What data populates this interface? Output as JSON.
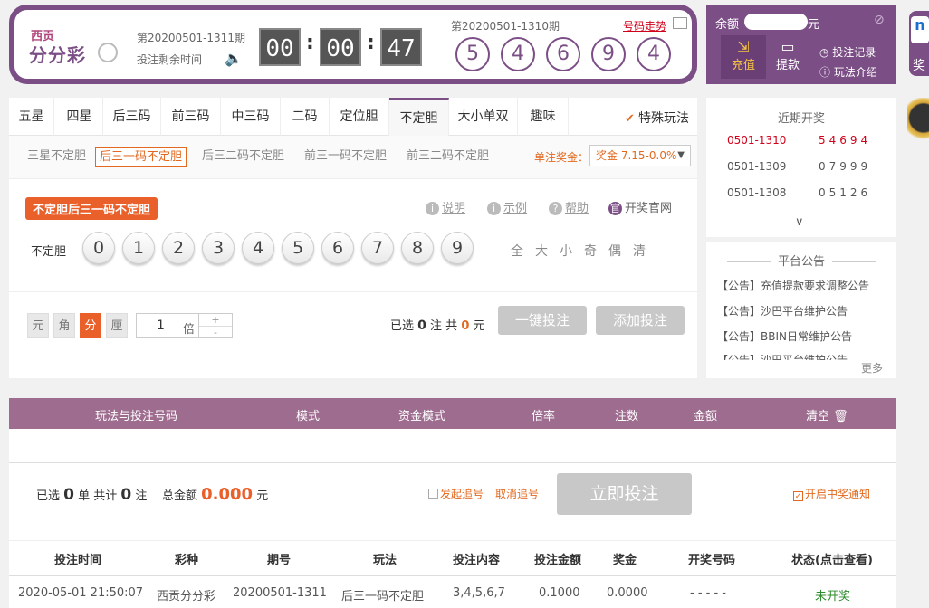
{
  "header": {
    "logo_small": "西贡",
    "logo_big": "分分彩",
    "period": "第20200501-1311期",
    "remain_label": "投注剩余时间",
    "timer": [
      "00",
      "00",
      "47"
    ],
    "prev_period": "第20200501-1310期",
    "trend_link": "号码走势",
    "prev_balls": [
      "5",
      "4",
      "6",
      "9",
      "4"
    ]
  },
  "account": {
    "balance_label": "余额",
    "balance_unit": "元",
    "recharge": "充值",
    "withdraw": "提款",
    "bet_records": "投注记录",
    "rules": "玩法介绍"
  },
  "side_strip": {
    "logo": "n",
    "label": "奖"
  },
  "tabs": [
    "五星",
    "四星",
    "后三码",
    "前三码",
    "中三码",
    "二码",
    "定位胆",
    "不定胆",
    "大小单双",
    "趣味"
  ],
  "special": "特殊玩法",
  "subtabs": [
    "三星不定胆",
    "后三一码不定胆",
    "后三二码不定胆",
    "前三一码不定胆",
    "前三二码不定胆"
  ],
  "prize": {
    "label": "单注奖金：",
    "value": "奖金 7.15-0.0%"
  },
  "badge": "不定胆后三一码不定胆",
  "helps": [
    "说明",
    "示例",
    "帮助"
  ],
  "official": "开奖官网",
  "row_label": "不定胆",
  "numbers": [
    "0",
    "1",
    "2",
    "3",
    "4",
    "5",
    "6",
    "7",
    "8",
    "9"
  ],
  "quick": [
    "全",
    "大",
    "小",
    "奇",
    "偶",
    "清"
  ],
  "units": [
    "元",
    "角",
    "分",
    "厘"
  ],
  "multiplier": {
    "value": "1",
    "unit": "倍"
  },
  "selection": {
    "prefix": "已选",
    "count": "0",
    "mid": "注 共",
    "amount": "0",
    "suffix": "元"
  },
  "one_key_bet": "一键投注",
  "add_bet": "添加投注",
  "recent": {
    "title": "近期开奖",
    "draws": [
      {
        "period": "0501-1310",
        "nums": "54694"
      },
      {
        "period": "0501-1309",
        "nums": "07999"
      },
      {
        "period": "0501-1308",
        "nums": "05126"
      }
    ],
    "expand": "∨"
  },
  "notice": {
    "title": "平台公告",
    "items": [
      "【公告】充值提款要求调整公告",
      "【公告】沙巴平台维护公告",
      "【公告】BBIN日常维护公告",
      "【公告】沙巴平台维护公告"
    ],
    "more": "更多"
  },
  "cart_headers": [
    "玩法与投注号码",
    "模式",
    "资金模式",
    "倍率",
    "注数",
    "金额",
    "清空"
  ],
  "summary": {
    "sel_prefix": "已选",
    "sel_count": "0",
    "sel_unit": "单 共计",
    "note_count": "0",
    "note_unit": "注",
    "total_label": "总金额",
    "total": "0.000",
    "total_unit": "元",
    "chase": "发起追号",
    "cancel_chase": "取消追号",
    "bet_now": "立即投注",
    "notify": "开启中奖通知"
  },
  "history": {
    "headers": [
      "投注时间",
      "彩种",
      "期号",
      "玩法",
      "投注内容",
      "投注金额",
      "奖金",
      "开奖号码",
      "状态(点击查看)"
    ],
    "row": [
      "2020-05-01 21:50:07",
      "西贡分分彩",
      "20200501-1311",
      "后三一码不定胆",
      "3,4,5,6,7",
      "0.1000",
      "0.0000",
      "- - - - -",
      "未开奖"
    ]
  },
  "colors": {
    "brand": "#7b4f86",
    "accent": "#e9602b",
    "status_pending": "#2e8b2e"
  }
}
